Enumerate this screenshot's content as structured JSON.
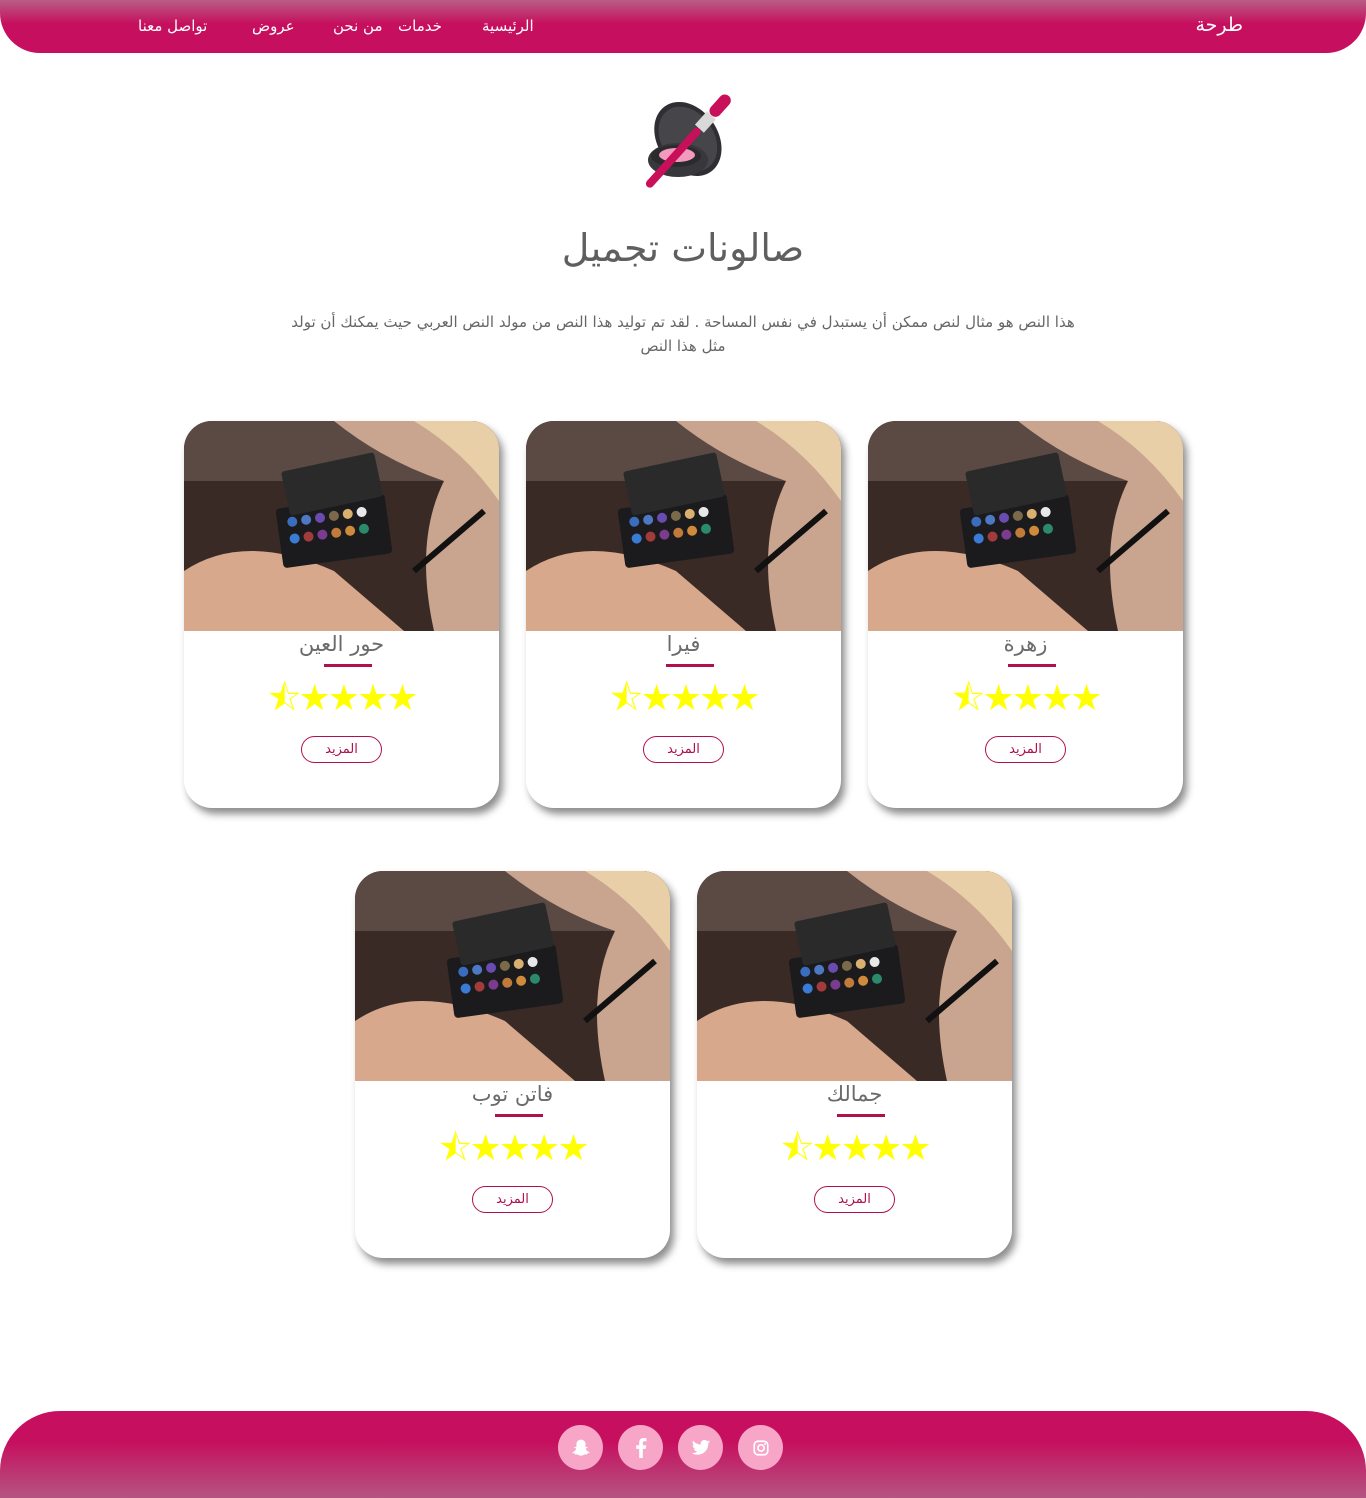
{
  "header": {
    "brand": "طرحة",
    "nav": [
      {
        "label": "الرئيسية"
      },
      {
        "label": "خدمات"
      },
      {
        "label": "من نحن"
      },
      {
        "label": "عروض"
      },
      {
        "label": "تواصل معنا"
      }
    ]
  },
  "hero": {
    "icon": "makeup-compact-brush-icon",
    "title": "صالونات تجميل",
    "intro": "هذا النص هو مثال لنص ممكن أن يستبدل في نفس المساحة . لقد تم توليد هذا النص من مولد النص العربي حيث يمكنك أن تولد مثل هذا النص"
  },
  "cards": [
    {
      "name": "زهرة",
      "rating": 4.5,
      "stars": "★★★★",
      "button": "المزيد"
    },
    {
      "name": "فيرا",
      "rating": 4.5,
      "stars": "★★★★",
      "button": "المزيد"
    },
    {
      "name": "حور العين",
      "rating": 4.5,
      "stars": "★★★★",
      "button": "المزيد"
    },
    {
      "name": "جمالك",
      "rating": 4.5,
      "stars": "★★★★",
      "button": "المزيد"
    },
    {
      "name": "فاتن توب",
      "rating": 4.5,
      "stars": "★★★★",
      "button": "المزيد"
    }
  ],
  "footer": {
    "social": [
      {
        "icon": "instagram-icon"
      },
      {
        "icon": "twitter-icon"
      },
      {
        "icon": "facebook-icon"
      },
      {
        "icon": "snapchat-icon"
      }
    ]
  },
  "colors": {
    "accent": "#c60f5e",
    "accent_light": "#f7a6c8",
    "star": "#ffff00"
  }
}
